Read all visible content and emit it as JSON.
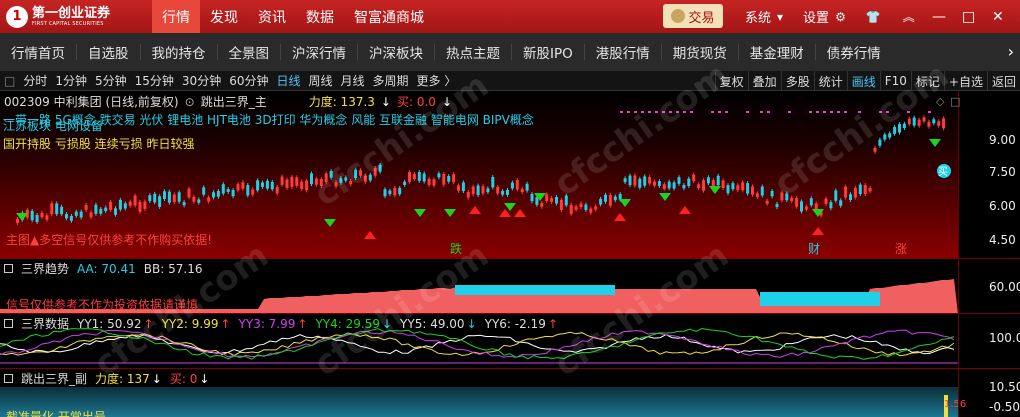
{
  "topbar": {
    "logo_mark": "1",
    "logo_cn": "第一创业证券",
    "logo_en": "FIRST CAPITAL SECURITIES",
    "nav": [
      "行情",
      "发现",
      "资讯",
      "数据",
      "智富通商城"
    ],
    "trade_label": "交易",
    "system_label": "系统",
    "settings_label": "设置",
    "window_controls": [
      "—",
      "□",
      "✕"
    ]
  },
  "subnav": {
    "items": [
      "行情首页",
      "自选股",
      "我的持仓",
      "全景图",
      "沪深行情",
      "沪深板块",
      "热点主题",
      "新股IPO",
      "港股行情",
      "期货现货",
      "基金理财",
      "债券行情"
    ],
    "next": "›"
  },
  "periodbar": {
    "items": [
      "分时",
      "1分钟",
      "5分钟",
      "15分钟",
      "30分钟",
      "60分钟",
      "日线",
      "周线",
      "月线",
      "多周期",
      "更多 〉"
    ],
    "active": "日线",
    "tools": [
      "复权",
      "叠加",
      "多股",
      "统计",
      "画线",
      "F10",
      "标记",
      "+自选",
      "返回"
    ],
    "active_tool": "画线"
  },
  "main": {
    "stock_title": "002309 中利集团 (日线,前复权)",
    "indicator": "跳出三界_主",
    "power": "力度: 137.3",
    "buy": "买: 0.0",
    "concepts": "一带一路 5G概念 跌交易 光伏 锂电池 HJT电池 3D打印 华为概念 风能 互联金融 智能电网 BIPV概念",
    "concepts2": "江苏板块 电网设备",
    "tags2": "国开持股 亏损股 连续亏损 昨日较强",
    "note": "主图▲多空信号仅供参考不作购买依据!",
    "events": [
      "跌",
      "财",
      "涨"
    ],
    "yticks": [
      "9.00",
      "7.50",
      "6.00",
      "4.50"
    ],
    "cur_label": "买"
  },
  "panel_trend": {
    "name": "三界趋势",
    "aa": "AA: 70.41",
    "bb": "BB: 57.16",
    "ylabel": "60.00",
    "note": "信号仅供参考不作为投资依据请谨慎"
  },
  "panel_data": {
    "name": "三界数据",
    "yy1": "YY1: 50.92",
    "yy2": "YY2: 9.99",
    "yy3": "YY3: 7.99",
    "yy4": "YY4: 29.59",
    "yy5": "YY5: 49.00",
    "yy6": "YY6: -2.19",
    "ylabel": "100.0"
  },
  "panel_sub": {
    "name": "跳出三界_副",
    "power": "力度: 137",
    "buy": "买: 0",
    "ylabel1": "10.50",
    "ylabel2": "-0.50",
    "note": "截准量化 开常出号",
    "marker": "1.56"
  },
  "watermark": "cfcchi.com",
  "colors": {
    "up": "#ff3b3b",
    "down": "#1ed0e8",
    "accent": "#c62424",
    "buy_sig": "#1bd41b",
    "sell_sig": "#ff2020"
  }
}
